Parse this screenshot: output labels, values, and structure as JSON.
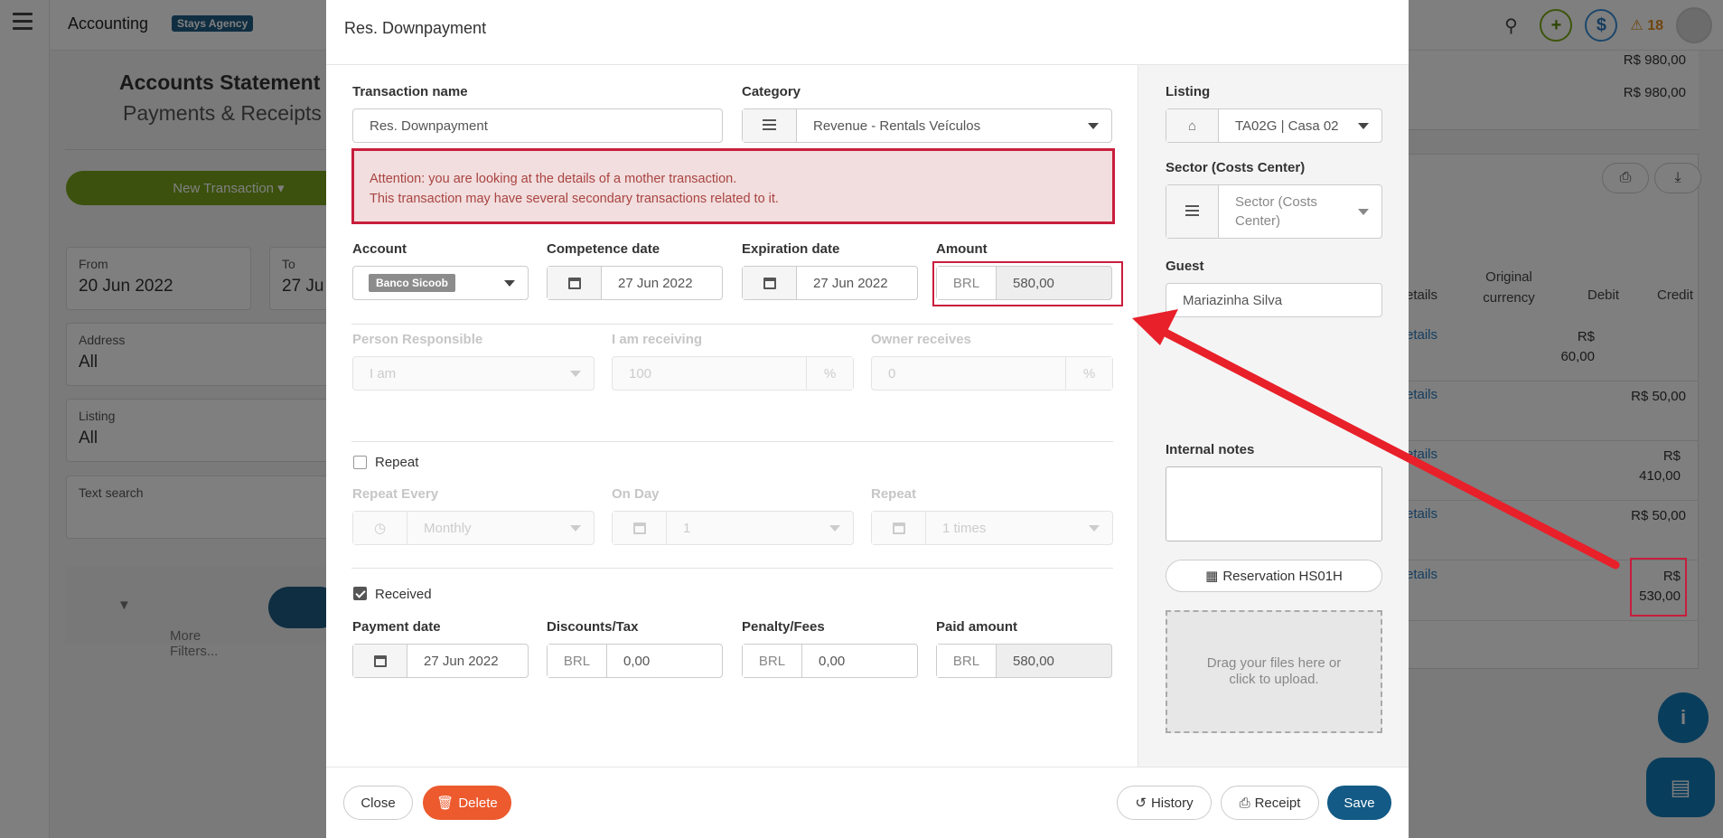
{
  "app": {
    "title": "Accounting",
    "agency_badge": "Stays Agency",
    "alerts_count": "18"
  },
  "background": {
    "page_title": "Accounts Statement",
    "page_subtitle": "Payments & Receipts",
    "new_transaction_label": "New Transaction",
    "filters": {
      "from_label": "From",
      "from_value": "20 Jun 2022",
      "to_label": "To",
      "to_value": "27 Ju",
      "address_label": "Address",
      "address_value": "All",
      "listing_label": "Listing",
      "listing_value": "All",
      "text_search_label": "Text search"
    },
    "more_filters_label": "More Filters...",
    "top_amounts": [
      "R$ 980,00",
      "R$ 980,00"
    ],
    "table_headers": {
      "details": "etails",
      "original_currency": "Original currency",
      "debit": "Debit",
      "credit": "Credit"
    },
    "rows": [
      {
        "link": "etails",
        "debit": "R$ 60,00",
        "credit": ""
      },
      {
        "link": "etails",
        "debit": "",
        "credit": "R$ 50,00"
      },
      {
        "link": "etails",
        "debit": "",
        "credit": "R$ 410,00"
      },
      {
        "link": "etails",
        "debit": "",
        "credit": "R$ 50,00"
      },
      {
        "link": "etails",
        "debit": "",
        "credit": "R$ 530,00"
      }
    ]
  },
  "modal": {
    "title": "Res. Downpayment",
    "transaction_name": {
      "label": "Transaction name",
      "value": "Res. Downpayment"
    },
    "category": {
      "label": "Category",
      "value": "Revenue - Rentals Veículos"
    },
    "alert": {
      "line1": "Attention: you are looking at the details of a mother transaction.",
      "line2": "This transaction may have several secondary transactions related to it."
    },
    "account": {
      "label": "Account",
      "value": "Banco Sicoob"
    },
    "competence_date": {
      "label": "Competence date",
      "value": "27 Jun 2022"
    },
    "expiration_date": {
      "label": "Expiration date",
      "value": "27 Jun 2022"
    },
    "amount": {
      "label": "Amount",
      "currency": "BRL",
      "value": "580,00"
    },
    "person_responsible": {
      "label": "Person Responsible",
      "value": "I am"
    },
    "i_am_receiving": {
      "label": "I am receiving",
      "value": "100",
      "unit": "%"
    },
    "owner_receives": {
      "label": "Owner receives",
      "value": "0",
      "unit": "%"
    },
    "repeat_checkbox": {
      "label": "Repeat",
      "checked": false
    },
    "repeat_every": {
      "label": "Repeat Every",
      "value": "Monthly"
    },
    "on_day": {
      "label": "On Day",
      "value": "1"
    },
    "repeat_times": {
      "label": "Repeat",
      "value": "1 times"
    },
    "received_checkbox": {
      "label": "Received",
      "checked": true
    },
    "payment_date": {
      "label": "Payment date",
      "value": "27 Jun 2022"
    },
    "discounts": {
      "label": "Discounts/Tax",
      "currency": "BRL",
      "value": "0,00"
    },
    "penalty": {
      "label": "Penalty/Fees",
      "currency": "BRL",
      "value": "0,00"
    },
    "paid_amount": {
      "label": "Paid amount",
      "currency": "BRL",
      "value": "580,00"
    },
    "listing": {
      "label": "Listing",
      "value": "TA02G | Casa 02"
    },
    "sector": {
      "label": "Sector (Costs Center)",
      "placeholder": "Sector (Costs Center)"
    },
    "guest": {
      "label": "Guest",
      "value": "Mariazinha Silva"
    },
    "internal_notes": {
      "label": "Internal notes",
      "value": ""
    },
    "reservation_button": "Reservation HS01H",
    "dropzone_text": "Drag your files here or click to upload.",
    "footer": {
      "close": "Close",
      "delete": "Delete",
      "history": "History",
      "receipt": "Receipt",
      "save": "Save"
    }
  },
  "colors": {
    "primary": "#135a86",
    "danger": "#ec5a2e",
    "alert_border": "#c81e3c",
    "alert_bg": "#f2dede",
    "annotation_arrow": "#e8202a"
  }
}
